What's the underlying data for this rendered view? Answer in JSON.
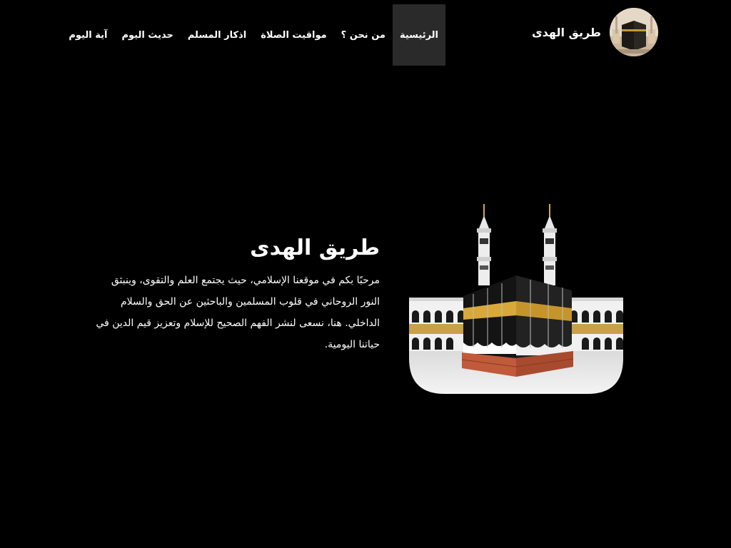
{
  "header": {
    "brand_name": "طريق الهدى",
    "logo_icon": "kaaba-icon",
    "nav": [
      {
        "label": "الرئيسية",
        "active": true
      },
      {
        "label": "من نحن ؟",
        "active": false
      },
      {
        "label": "مواقيت الصلاة",
        "active": false
      },
      {
        "label": "اذكار المسلم",
        "active": false
      },
      {
        "label": "حديث اليوم",
        "active": false
      },
      {
        "label": "آية اليوم",
        "active": false
      }
    ]
  },
  "hero": {
    "title": "طريق الهدى",
    "paragraph": "مرحبًا بكم في موقعنا الإسلامي، حيث يجتمع العلم والتقوى، وينبثق النور الروحاني في قلوب المسلمين والباحثين عن الحق والسلام الداخلي. هنا، نسعى لنشر الفهم الصحيح للإسلام وتعزيز قيم الدين في حياتنا اليومية.",
    "image_icon": "kaaba-illustration"
  },
  "colors": {
    "background": "#000000",
    "text": "#ffffff",
    "active_nav": "#2a2a2a",
    "kaaba_gold": "#d8a93a"
  }
}
